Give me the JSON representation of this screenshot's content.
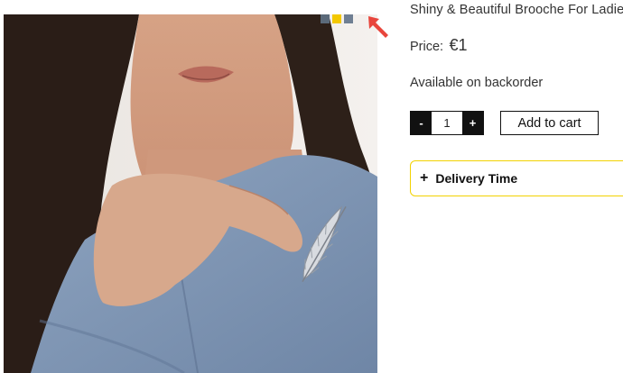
{
  "product": {
    "title": "Shiny & Beautiful Brooche For Ladies",
    "price_label": "Price:",
    "price_value": "€1",
    "availability": "Available on backorder",
    "image_alt": "Woman in blue blouse wearing a silver feather brooch"
  },
  "swatches": [
    {
      "name": "Slate",
      "color": "#5b6a7a"
    },
    {
      "name": "Yellow",
      "color": "#f3c800"
    },
    {
      "name": "Blue grey",
      "color": "#6f7f93"
    }
  ],
  "quantity": {
    "minus_label": "-",
    "value": "1",
    "plus_label": "+"
  },
  "cart": {
    "button_label": "Add to cart"
  },
  "accordion": {
    "icon": "plus-icon",
    "label": "Delivery Time",
    "border_color": "#f2d200"
  },
  "annotation": {
    "icon": "red-arrow-icon",
    "color": "#e8453c"
  }
}
